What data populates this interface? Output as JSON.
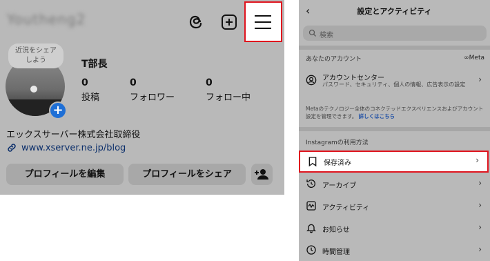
{
  "left": {
    "username": "Youtheng2",
    "note_line1": "近況をシェア",
    "note_line2": "しよう",
    "plus_badge": "+",
    "name": "T部長",
    "stats": [
      {
        "num": "0",
        "label": "投稿"
      },
      {
        "num": "0",
        "label": "フォロワー"
      },
      {
        "num": "0",
        "label": "フォロー中"
      }
    ],
    "bio": "エックスサーバー株式会社取締役",
    "link": "www.xserver.ne.jp/blog",
    "edit_button": "プロフィールを編集",
    "share_button": "プロフィールをシェア"
  },
  "right": {
    "title": "設定とアクティビティ",
    "back": "‹",
    "search_placeholder": "検索",
    "your_account": "あなたのアカウント",
    "meta_brand": "∞Meta",
    "account_center": "アカウントセンター",
    "account_center_sub": "パスワード、セキュリティ、個人の情報、広告表示の設定",
    "meta_note": "Metaのテクノロジー全体のコネクテッドエクスペリエンスおよびアカウント設定を管理できます。",
    "meta_note_link": "詳しくはこちら",
    "how_to_use": "Instagramの利用方法",
    "rows": [
      "保存済み",
      "アーカイブ",
      "アクティビティ",
      "お知らせ",
      "時間管理"
    ],
    "chevron": "›"
  }
}
